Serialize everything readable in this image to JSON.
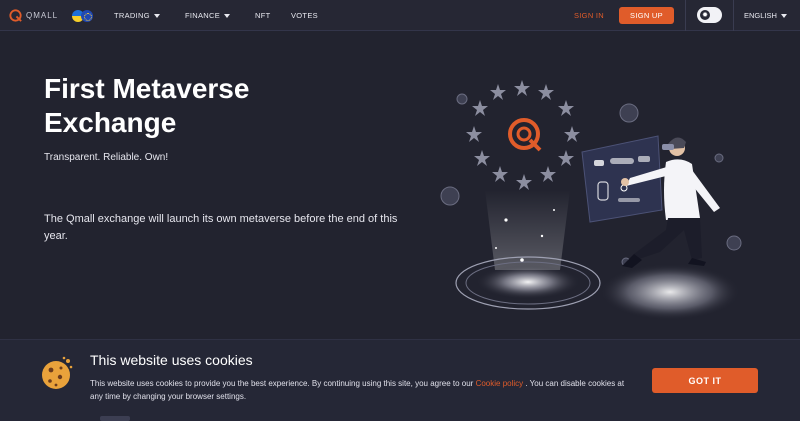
{
  "header": {
    "logo_text": "QMALL",
    "nav": [
      {
        "label": "TRADING",
        "dropdown": true
      },
      {
        "label": "FINANCE",
        "dropdown": true
      },
      {
        "label": "NFT",
        "dropdown": false
      },
      {
        "label": "VOTES",
        "dropdown": false
      }
    ],
    "signin_label": "SIGN IN",
    "signup_label": "SIGN UP",
    "theme_toggle_icon": "sun-icon",
    "language": "ENGLISH"
  },
  "hero": {
    "title": "First Metaverse Exchange",
    "subtitle": "Transparent. Reliable. Own!",
    "description": "The Qmall exchange will launch its own metaverse before the end of this year."
  },
  "cookie": {
    "title": "This website uses cookies",
    "text_before": "This website uses cookies to provide you the best experience. By continuing using this site, you agree to our ",
    "link": "Cookie policy",
    "text_after": " . You can disable cookies at any time by changing your browser settings.",
    "button": "GOT IT"
  },
  "colors": {
    "accent": "#e05c2a",
    "background": "#22232f",
    "header": "#262734"
  }
}
